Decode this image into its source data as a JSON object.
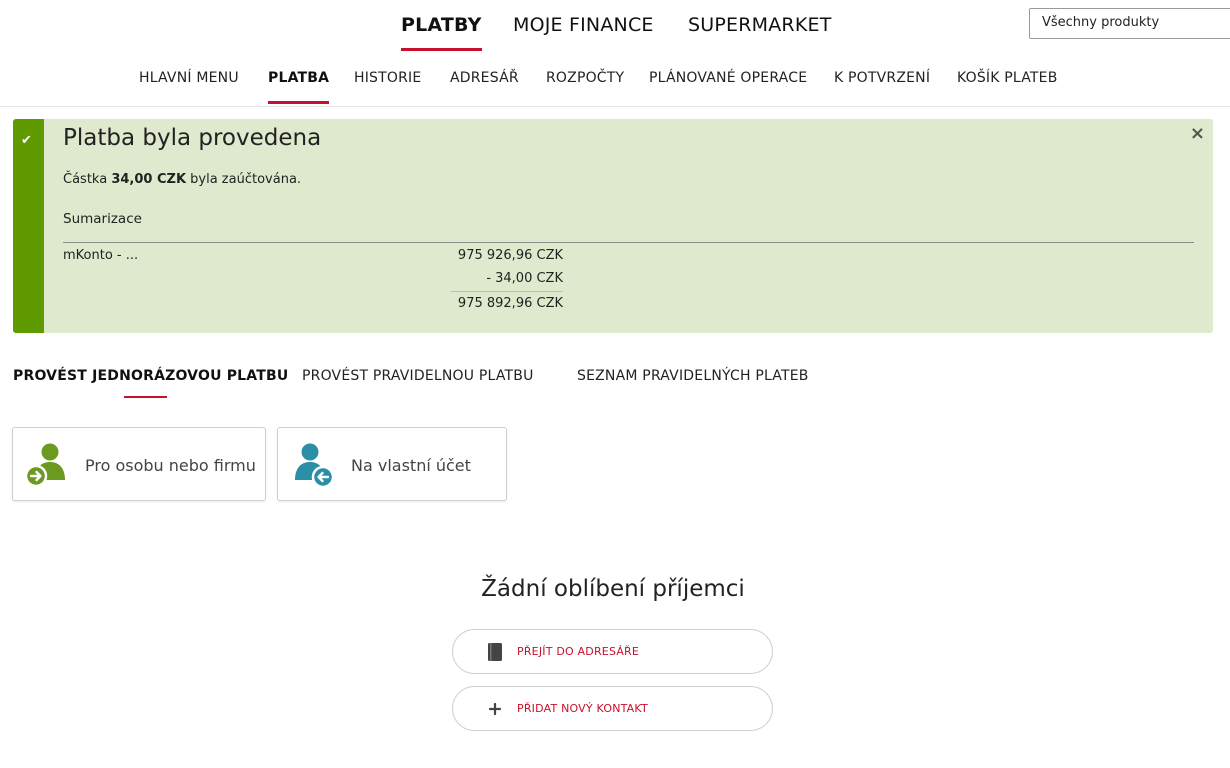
{
  "top_nav": {
    "tabs": [
      {
        "label": "PLATBY",
        "active": true
      },
      {
        "label": "MOJE FINANCE",
        "active": false
      },
      {
        "label": "SUPERMARKET",
        "active": false
      }
    ],
    "product_select": "Všechny produkty"
  },
  "sub_nav": {
    "tabs": [
      {
        "label": "HLAVNÍ MENU",
        "active": false
      },
      {
        "label": "PLATBA",
        "active": true
      },
      {
        "label": "HISTORIE",
        "active": false
      },
      {
        "label": "ADRESÁŘ",
        "active": false
      },
      {
        "label": "ROZPOČTY",
        "active": false
      },
      {
        "label": "PLÁNOVANÉ OPERACE",
        "active": false
      },
      {
        "label": "K POTVRZENÍ",
        "active": false
      },
      {
        "label": "KOŠÍK PLATEB",
        "active": false
      }
    ]
  },
  "alert": {
    "title": "Platba byla provedena",
    "amount_prefix": "Částka",
    "amount": "34,00 CZK",
    "amount_suffix": "byla zaúčtována.",
    "summary_label": "Sumarizace",
    "account": "mKonto - ...",
    "balance_before": "975 926,96 CZK",
    "change": "- 34,00 CZK",
    "balance_after": "975 892,96 CZK",
    "close": "×",
    "check": "✔",
    "color": "#5e9a00",
    "background": "#dfe9cd"
  },
  "payment_tabs": [
    {
      "label": "PROVÉST JEDNORÁZOVOU PLATBU",
      "active": true
    },
    {
      "label": "PROVÉST PRAVIDELNOU PLATBU",
      "active": false
    },
    {
      "label": "SEZNAM PRAVIDELNÝCH PLATEB",
      "active": false
    }
  ],
  "cards": [
    {
      "label": "Pro osobu nebo firmu",
      "icon": "person-arrow-right-icon",
      "color": "#6a9a1f"
    },
    {
      "label": "Na vlastní účet",
      "icon": "person-arrow-left-icon",
      "color": "#2a8fa6"
    }
  ],
  "favorites": {
    "title": "Žádní oblíbení příjemci",
    "buttons": [
      {
        "label": "PŘEJÍT DO ADRESÁŘE",
        "icon": "address-book-icon"
      },
      {
        "label": "PŘIDAT NOVÝ KONTAKT",
        "icon": "plus-icon"
      }
    ]
  },
  "accent_color": "#c8102e"
}
